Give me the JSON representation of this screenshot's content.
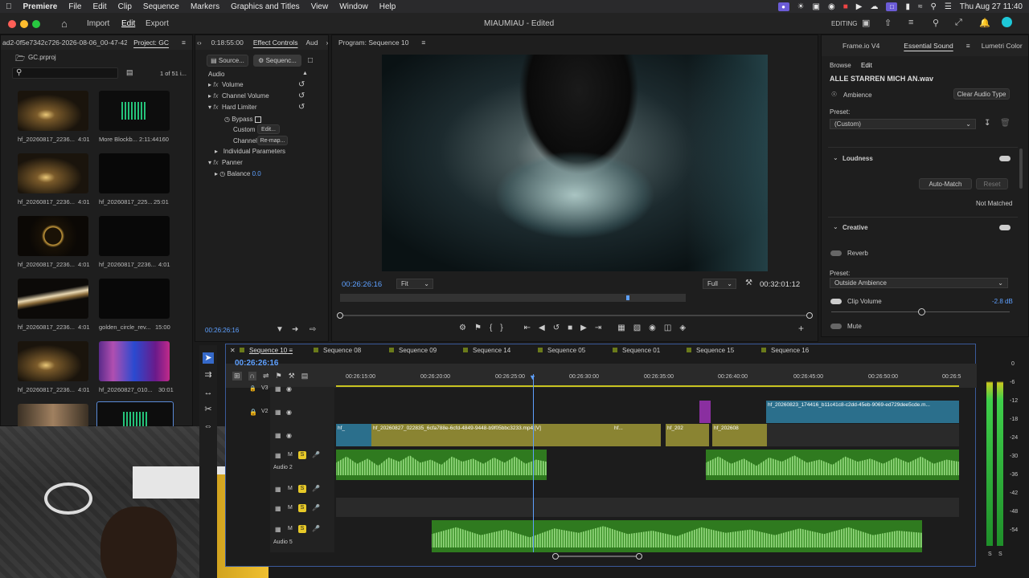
{
  "menubar": {
    "app": "Premiere",
    "items": [
      "File",
      "Edit",
      "Clip",
      "Sequence",
      "Markers",
      "Graphics and Titles",
      "View",
      "Window",
      "Help"
    ],
    "datetime": "Thu Aug 27  11:40"
  },
  "titlebar": {
    "nav": [
      "Import",
      "Edit",
      "Export"
    ],
    "title": "MIAUMIAU - Edited",
    "workspace": "EDITING"
  },
  "project": {
    "tabs": [
      "ad2-0f5e7342c726-2026-08-06_00-47-42",
      "Project: GC"
    ],
    "file": "GC.prproj",
    "count": "1 of 51 i...",
    "items": [
      {
        "name": "hf_20260817_2236...",
        "dur": "4:01"
      },
      {
        "name": "More Blockb...",
        "dur": "2:11:44160"
      },
      {
        "name": "hf_20260817_2236...",
        "dur": "4:01"
      },
      {
        "name": "hf_20260817_225...",
        "dur": "25:01"
      },
      {
        "name": "hf_20260817_2236...",
        "dur": "4:01"
      },
      {
        "name": "hf_20260817_2236...",
        "dur": "4:01"
      },
      {
        "name": "hf_20260817_2236...",
        "dur": "4:01"
      },
      {
        "name": "golden_circle_rev...",
        "dur": "15:00"
      },
      {
        "name": "hf_20260817_2236...",
        "dur": "4:01"
      },
      {
        "name": "hf_20260827_010...",
        "dur": "30:01"
      }
    ]
  },
  "effects": {
    "tabs": [
      "0:18:55:00",
      "Effect Controls",
      "Aud"
    ],
    "sub_tabs": [
      "Source...",
      "Sequenc..."
    ],
    "rows": {
      "audio": "Audio",
      "volume": "Volume",
      "channel_volume": "Channel Volume",
      "hard_limiter": "Hard Limiter",
      "bypass": "Bypass",
      "custom": "Custom",
      "edit_btn": "Edit...",
      "channel": "Channel",
      "remap": "Re-map...",
      "individual": "Individual Parameters",
      "panner": "Panner",
      "balance": "Balance",
      "balance_val": "0.0"
    },
    "timecode": "00:26:26:16"
  },
  "program": {
    "title": "Program: Sequence 10",
    "timecode": "00:26:26:16",
    "fit": "Fit",
    "quality": "Full",
    "duration": "00:32:01:12"
  },
  "timeline": {
    "tabs": [
      "Sequence 10",
      "Sequence 08",
      "Sequence 09",
      "Sequence 14",
      "Sequence 05",
      "Sequence 01",
      "Sequence 15",
      "Sequence 16"
    ],
    "timecode": "00:26:26:16",
    "ruler": [
      "00:26:15:00",
      "00:26:20:00",
      "00:26:25:00",
      "00:26:30:00",
      "00:26:35:00",
      "00:26:40:00",
      "00:26:45:00",
      "00:26:50:00",
      "00:26:5"
    ],
    "tracks": {
      "v3": "V3",
      "v2": "V2",
      "audio2": "Audio 2",
      "audio5": "Audio 5",
      "m": "M",
      "s": "S"
    },
    "clips": {
      "v2": "hf_20260823_174416_b11c41c8-c2dd-45eb-9069-ed729dee5cde.m...",
      "v1a": "hf_",
      "v1b": "hf_20260827_022835_6cfa788e-6cfd-4849-9448-b9f05bbc3233.mp4 [V]",
      "v1c": "hf...",
      "v1d": "hf_202",
      "v1e": "hf_202608"
    }
  },
  "essential": {
    "tabs": [
      "Frame.io V4",
      "Essential Sound",
      "Lumetri Color"
    ],
    "subtabs": [
      "Browse",
      "Edit"
    ],
    "file": "ALLE STARREN MICH AN.wav",
    "type": "Ambience",
    "clear": "Clear Audio Type",
    "preset_label": "Preset:",
    "preset": "(Custom)",
    "loudness": "Loudness",
    "auto_match": "Auto-Match",
    "reset": "Reset",
    "not_matched": "Not Matched",
    "creative": "Creative",
    "reverb": "Reverb",
    "preset2_label": "Preset:",
    "preset2": "Outside Ambience",
    "clip_volume": "Clip Volume",
    "clip_volume_val": "-2.8 dB",
    "mute": "Mute"
  },
  "meter": {
    "labels": [
      "0",
      "-6",
      "-12",
      "-18",
      "-24",
      "-30",
      "-36",
      "-42",
      "-48",
      "-54"
    ],
    "solo": [
      "S",
      "S"
    ]
  }
}
